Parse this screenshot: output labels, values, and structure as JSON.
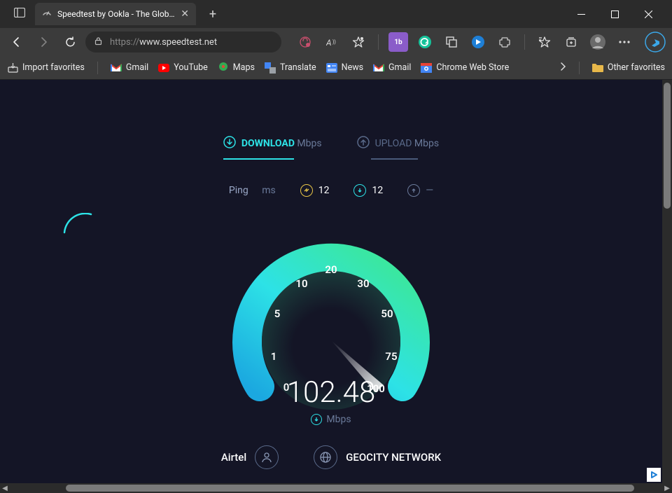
{
  "window": {
    "tab_title": "Speedtest by Ookla - The Global"
  },
  "toolbar": {
    "url_host": "www.speedtest.net",
    "url_prefix": "https://"
  },
  "bookmarks": {
    "import": "Import favorites",
    "items": [
      {
        "label": "Gmail"
      },
      {
        "label": "YouTube"
      },
      {
        "label": "Maps"
      },
      {
        "label": "Translate"
      },
      {
        "label": "News"
      },
      {
        "label": "Gmail"
      },
      {
        "label": "Chrome Web Store"
      }
    ],
    "other": "Other favorites"
  },
  "speedtest": {
    "tabs": {
      "download": {
        "label": "DOWNLOAD",
        "unit": "Mbps"
      },
      "upload": {
        "label": "UPLOAD",
        "unit": "Mbps"
      }
    },
    "ping": {
      "label": "Ping",
      "unit": "ms",
      "idle": "12",
      "down": "12",
      "up": "—"
    },
    "gauge": {
      "ticks": [
        "0",
        "1",
        "5",
        "10",
        "20",
        "30",
        "50",
        "75",
        "100"
      ],
      "value": "102.48",
      "unit": "Mbps"
    },
    "isp": "Airtel",
    "server": "GEOCITY NETWORK"
  }
}
